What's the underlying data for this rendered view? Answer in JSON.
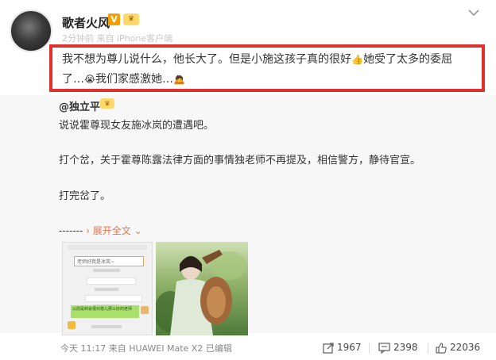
{
  "author": {
    "name": "歌者火风",
    "verified_badge": "V",
    "meta_text": "2分钟前 来自 iPhone客户端"
  },
  "post": {
    "line1_a": "我不想为尊儿说什么，他长大了。但是小施这孩子真的很好",
    "line1_b": "她受了太多的委屈",
    "line2_a": "了…",
    "line2_b": "我们家感激她…"
  },
  "repost": {
    "author": "@独立平",
    "lines": [
      "说说霍尊现女友施冰岚的遭遇吧。",
      "打个岔，关于霍尊陈露法律方面的事情独老师不再提及，相信警方，静待官宣。",
      "打完岔了。"
    ],
    "dashes": "-------",
    "expand_label": "展开全文"
  },
  "images": {
    "chat_bubbles": [
      "老师好我是冰岚~",
      "",
      "",
      "",
      "",
      "",
      "以前是到会很对尊儿那么好的老师"
    ]
  },
  "footer": {
    "time_source": "今天 11:17 来自 HUAWEI Mate X2 已编辑",
    "reposts": "1967",
    "comments": "2398",
    "likes": "22036"
  },
  "colors": {
    "highlight_border": "#e0312c",
    "link": "#eb7350",
    "verified": "#f3a000"
  }
}
